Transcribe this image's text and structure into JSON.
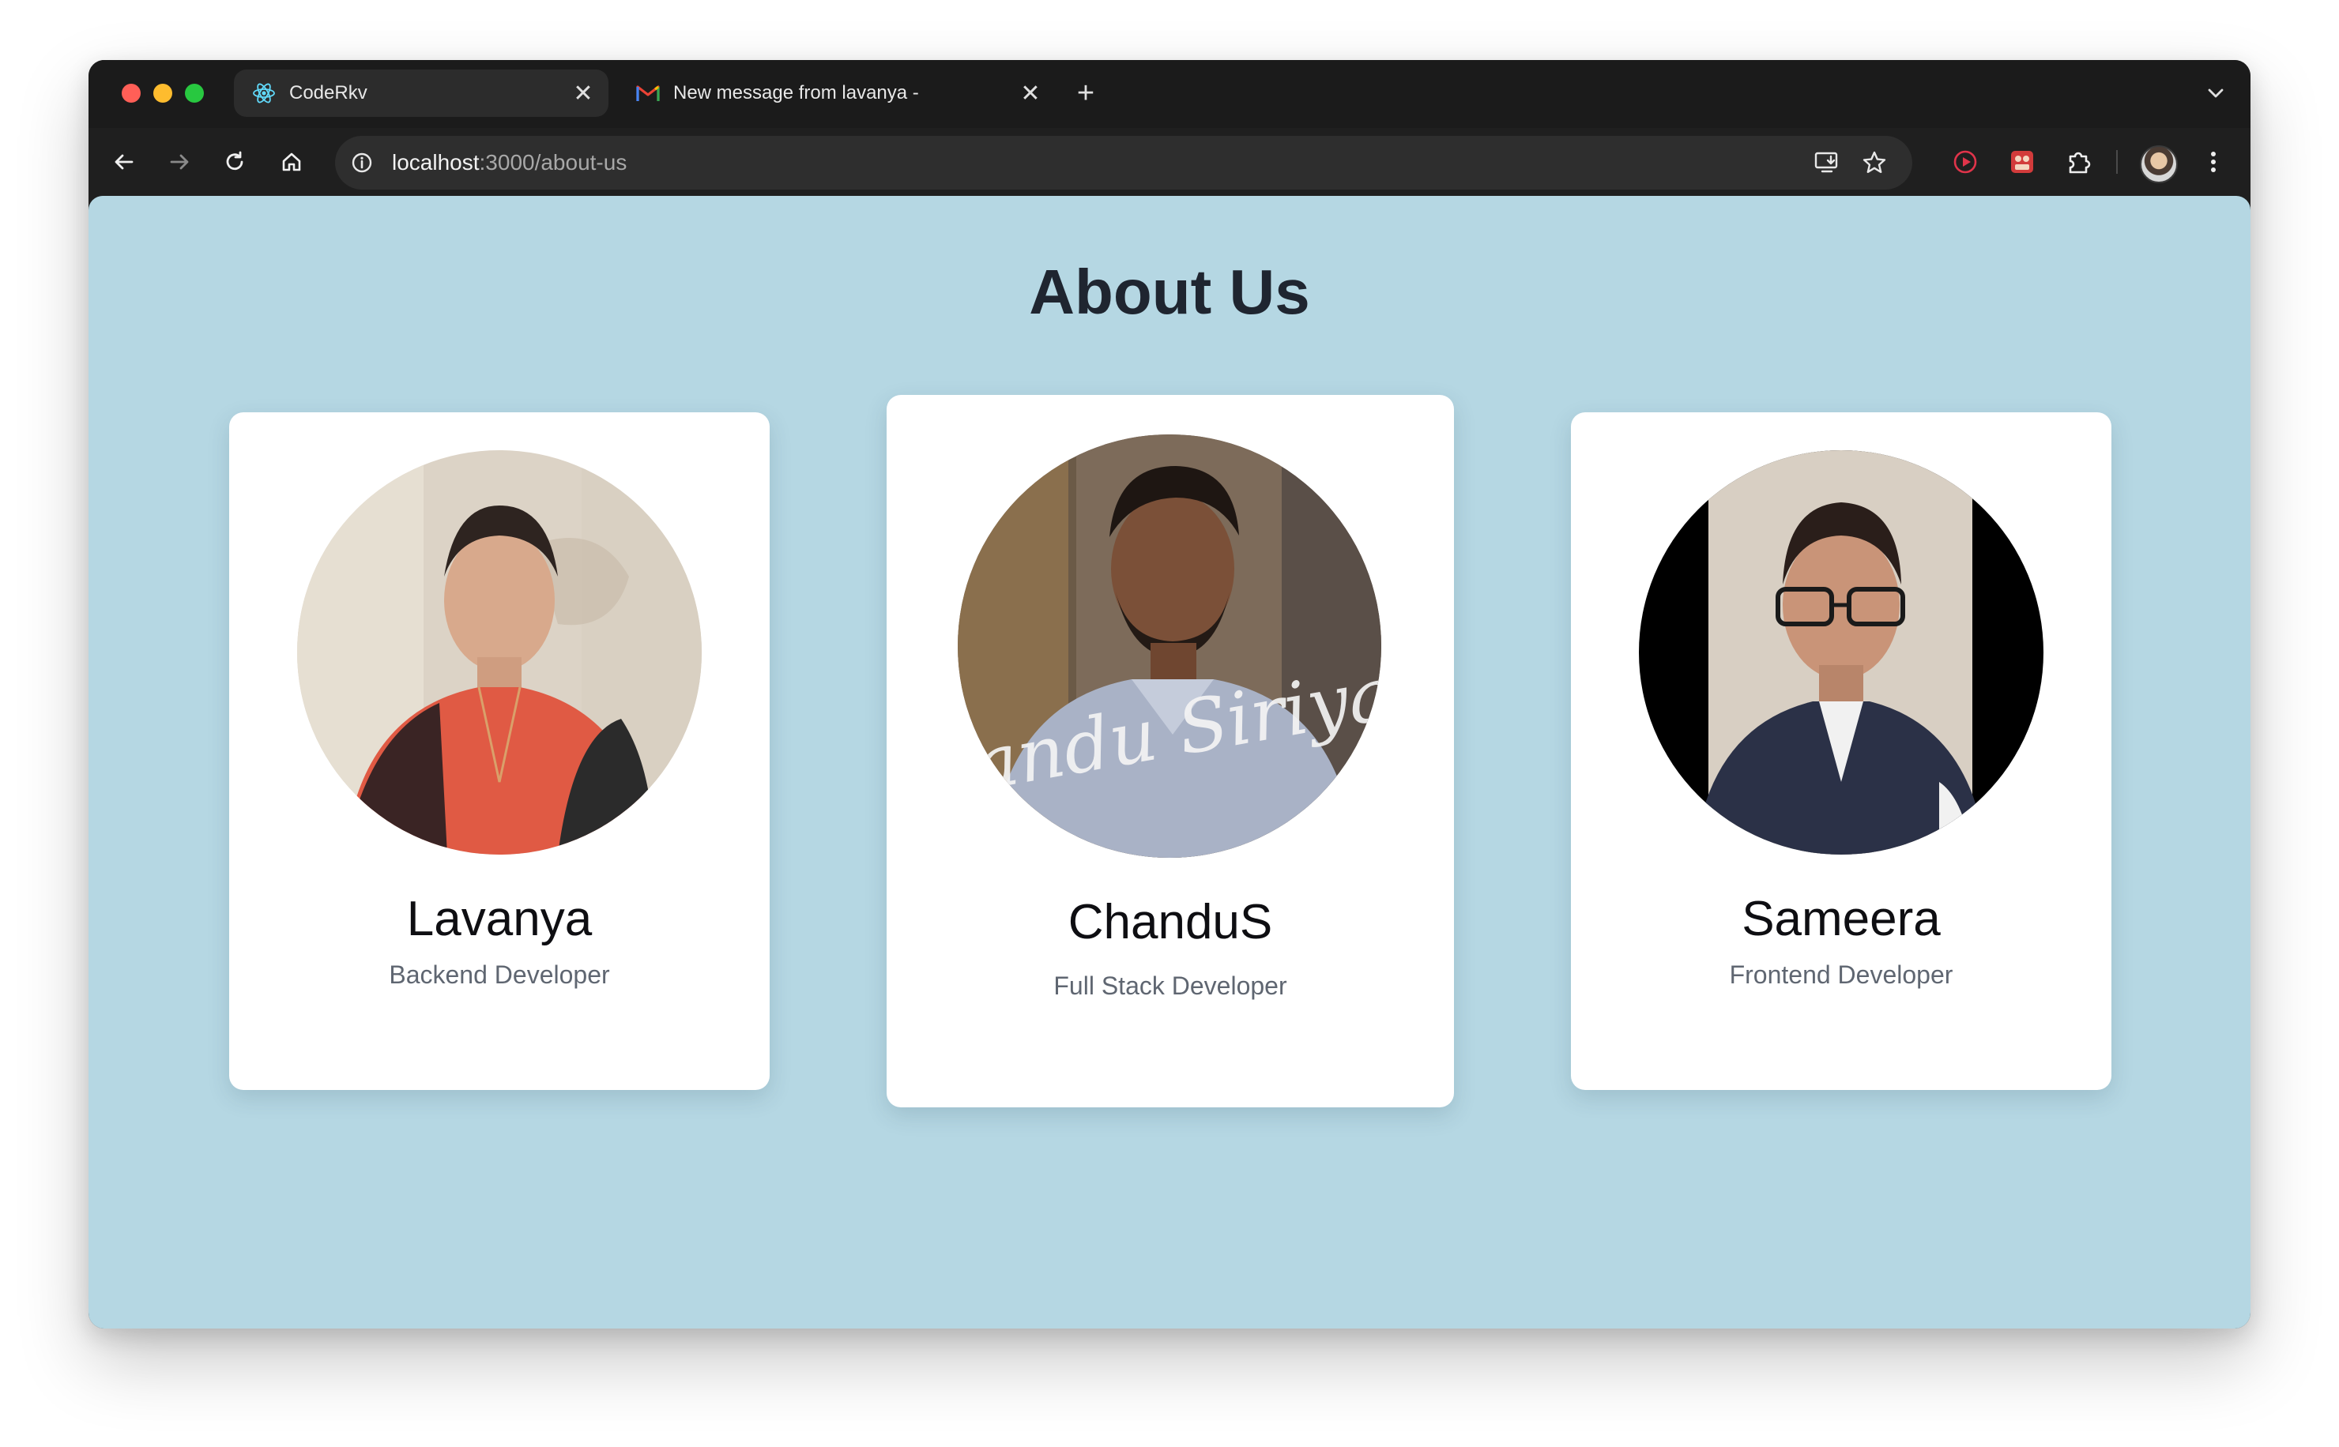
{
  "browser": {
    "tabs": [
      {
        "title": "CodeRkv",
        "active": true,
        "icon": "react-icon"
      },
      {
        "title": "New message from lavanya -",
        "active": false,
        "icon": "gmail-icon"
      }
    ],
    "new_tab_label": "+",
    "url": {
      "host": "localhost",
      "path": ":3000/about-us"
    }
  },
  "page": {
    "title": "About Us",
    "background": "#b5d7e3",
    "members": [
      {
        "name": "Lavanya",
        "role": "Backend Developer"
      },
      {
        "name": "ChanduS",
        "role": "Full Stack Developer",
        "photo_caption": "Chandu Siriyala"
      },
      {
        "name": "Sameera",
        "role": "Frontend Developer"
      }
    ]
  },
  "colors": {
    "accent_red": "#ff5f57",
    "accent_yellow": "#febc2e",
    "accent_green": "#28c840"
  }
}
